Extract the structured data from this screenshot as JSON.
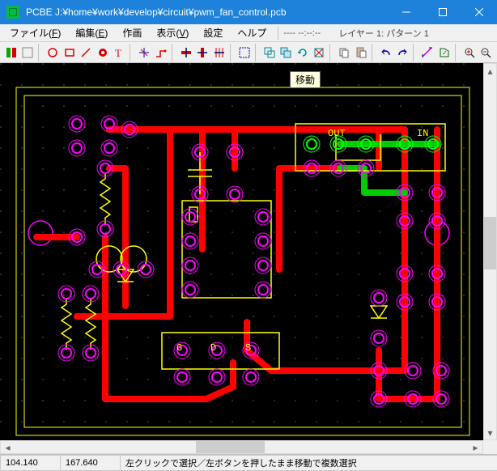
{
  "window": {
    "title": "PCBE  J:¥home¥work¥develop¥circuit¥pwm_fan_control.pcb"
  },
  "menu": {
    "file_pre": "ファイル(",
    "file_u": "F",
    "file_post": ")",
    "edit_pre": "編集(",
    "edit_u": "E",
    "edit_post": ")",
    "draw": "作画",
    "view_pre": "表示(",
    "view_u": "V",
    "view_post": ")",
    "settings": "設定",
    "help": "ヘルプ",
    "status": "----   --:--:--",
    "layer": "レイヤー 1: パターン 1"
  },
  "tooltip": "移動",
  "status": {
    "x": "104.140",
    "y": "167.640",
    "hint": "左クリックで選択／左ボタンを押したまま移動で複数選択"
  },
  "icons": {
    "min": "min",
    "max": "max",
    "close": "close"
  },
  "pcb_annotations": {
    "out": "OUT",
    "in": "IN",
    "g": "G",
    "d": "D",
    "s": "S"
  }
}
